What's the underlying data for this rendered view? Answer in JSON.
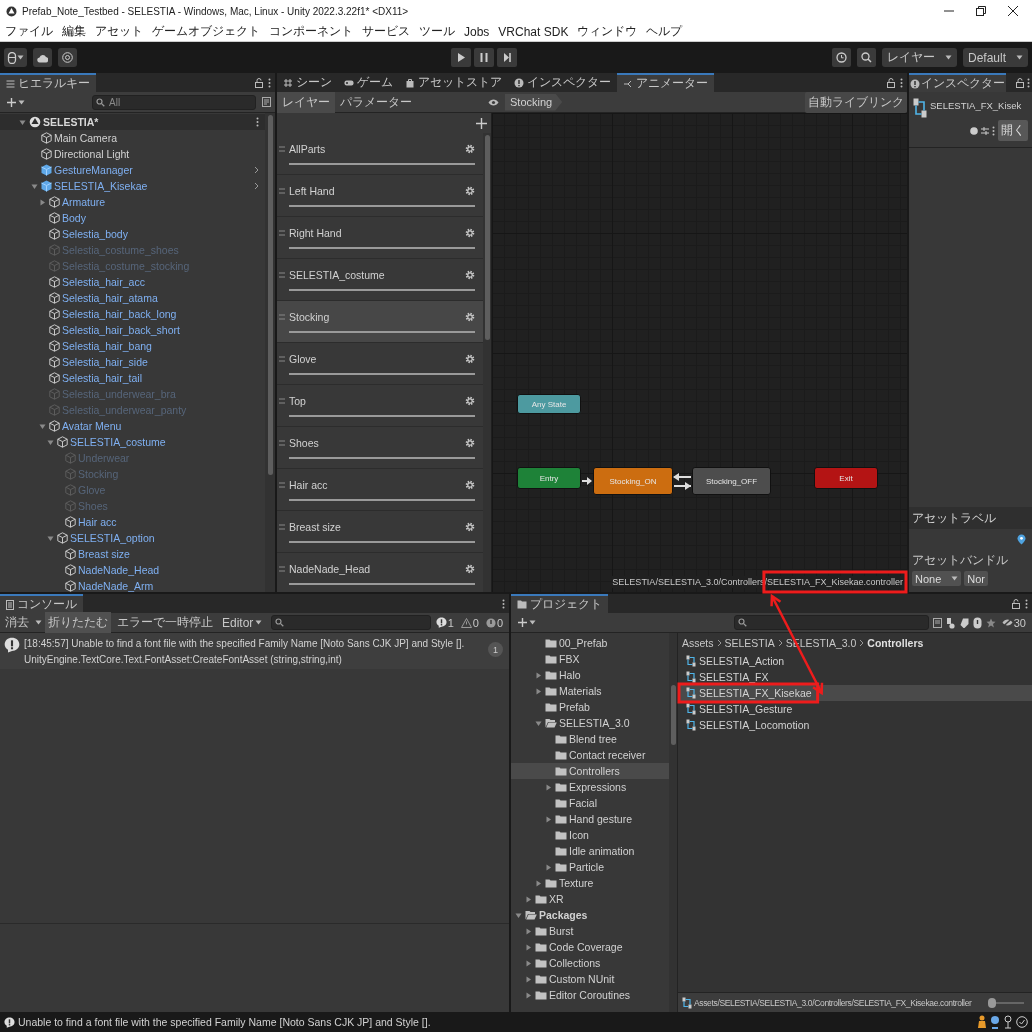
{
  "window": {
    "title": "Prefab_Note_Testbed - SELESTIA - Windows, Mac, Linux - Unity 2022.3.22f1* <DX11>"
  },
  "menu": [
    "ファイル",
    "編集",
    "アセット",
    "ゲームオブジェクト",
    "コンポーネント",
    "サービス",
    "ツール",
    "Jobs",
    "VRChat SDK",
    "ウィンドウ",
    "ヘルプ"
  ],
  "toolbar": {
    "layers_dropdown": "レイヤー",
    "layout_dropdown": "Default"
  },
  "hierarchy": {
    "tab": "ヒエラルキー",
    "search": {
      "placeholder": "All"
    },
    "tree": [
      {
        "label": "SELESTIA*",
        "kind": "scene",
        "expanded": true,
        "children": [
          {
            "label": "Main Camera",
            "kind": "object",
            "active": true
          },
          {
            "label": "Directional Light",
            "kind": "object",
            "active": true
          },
          {
            "label": "GestureManager",
            "kind": "prefab_root",
            "active": true
          },
          {
            "label": "SELESTIA_Kisekae",
            "kind": "prefab_root",
            "active": true,
            "expanded": true,
            "children": [
              {
                "label": "Armature",
                "kind": "prefab_child",
                "active": true,
                "expanded": false
              },
              {
                "label": "Body",
                "kind": "prefab_child",
                "active": true
              },
              {
                "label": "Selestia_body",
                "kind": "prefab_child",
                "active": true
              },
              {
                "label": "Selestia_costume_shoes",
                "kind": "prefab_child",
                "active": false
              },
              {
                "label": "Selestia_costume_stocking",
                "kind": "prefab_child",
                "active": false
              },
              {
                "label": "Selestia_hair_acc",
                "kind": "prefab_child",
                "active": true
              },
              {
                "label": "Selestia_hair_atama",
                "kind": "prefab_child",
                "active": true
              },
              {
                "label": "Selestia_hair_back_long",
                "kind": "prefab_child",
                "active": true
              },
              {
                "label": "Selestia_hair_back_short",
                "kind": "prefab_child",
                "active": true
              },
              {
                "label": "Selestia_hair_bang",
                "kind": "prefab_child",
                "active": true
              },
              {
                "label": "Selestia_hair_side",
                "kind": "prefab_child",
                "active": true
              },
              {
                "label": "Selestia_hair_tail",
                "kind": "prefab_child",
                "active": true
              },
              {
                "label": "Selestia_underwear_bra",
                "kind": "prefab_child",
                "active": false
              },
              {
                "label": "Selestia_underwear_panty",
                "kind": "prefab_child",
                "active": false
              },
              {
                "label": "Avatar Menu",
                "kind": "prefab_child",
                "active": true,
                "expanded": true,
                "children": [
                  {
                    "label": "SELESTIA_costume",
                    "kind": "prefab_child",
                    "active": true,
                    "expanded": true,
                    "children": [
                      {
                        "label": "Underwear",
                        "kind": "prefab_child",
                        "active": false
                      },
                      {
                        "label": "Stocking",
                        "kind": "prefab_child",
                        "active": false
                      },
                      {
                        "label": "Glove",
                        "kind": "prefab_child",
                        "active": false
                      },
                      {
                        "label": "Shoes",
                        "kind": "prefab_child",
                        "active": false
                      },
                      {
                        "label": "Hair acc",
                        "kind": "prefab_child",
                        "active": true
                      }
                    ]
                  },
                  {
                    "label": "SELESTIA_option",
                    "kind": "prefab_child",
                    "active": true,
                    "expanded": true,
                    "children": [
                      {
                        "label": "Breast size",
                        "kind": "prefab_child",
                        "active": true
                      },
                      {
                        "label": "NadeNade_Head",
                        "kind": "prefab_child",
                        "active": true
                      },
                      {
                        "label": "NadeNade_Arm",
                        "kind": "prefab_child",
                        "active": true
                      }
                    ]
                  }
                ]
              }
            ]
          }
        ]
      }
    ]
  },
  "center_tabs": [
    {
      "label": "シーン",
      "kind": "scene",
      "selected": false
    },
    {
      "label": "ゲーム",
      "kind": "game",
      "selected": false
    },
    {
      "label": "アセットストア",
      "kind": "store",
      "selected": false
    },
    {
      "label": "インスペクター",
      "kind": "inspector",
      "selected": false
    },
    {
      "label": "アニメーター",
      "kind": "animator",
      "selected": true
    }
  ],
  "animator": {
    "subtabs": [
      {
        "label": "レイヤー",
        "selected": true
      },
      {
        "label": "パラメーター",
        "selected": false
      }
    ],
    "breadcrumb": "Stocking",
    "live_link": "自動ライブリンク",
    "layers": [
      {
        "name": "AllParts",
        "selected": false
      },
      {
        "name": "Left Hand",
        "selected": false
      },
      {
        "name": "Right Hand",
        "selected": false
      },
      {
        "name": "SELESTIA_costume",
        "selected": false
      },
      {
        "name": "Stocking",
        "selected": true
      },
      {
        "name": "Glove",
        "selected": false
      },
      {
        "name": "Top",
        "selected": false
      },
      {
        "name": "Shoes",
        "selected": false
      },
      {
        "name": "Hair acc",
        "selected": false
      },
      {
        "name": "Breast size",
        "selected": false
      },
      {
        "name": "NadeNade_Head",
        "selected": false
      }
    ],
    "states": [
      {
        "name": "Any State",
        "kind": "any"
      },
      {
        "name": "Entry",
        "kind": "entry"
      },
      {
        "name": "Stocking_ON",
        "kind": "default"
      },
      {
        "name": "Stocking_OFF",
        "kind": "state"
      },
      {
        "name": "Exit",
        "kind": "exit"
      }
    ],
    "path": "SELESTIA/SELESTIA_3.0/Controllers/SELESTIA_FX_Kisekae.controller"
  },
  "inspector": {
    "tab": "インスペクター",
    "asset_name": "SELESTIA_FX_Kisek",
    "open_button": "開く",
    "labels_header": "アセットラベル",
    "bundle_label": "アセットバンドル",
    "bundle": "None",
    "variant": "Nor"
  },
  "console": {
    "tab": "コンソール",
    "clear": "消去",
    "toggles": [
      {
        "label": "折りたたむ",
        "on": true
      },
      {
        "label": "エラーで一時停止",
        "on": false
      }
    ],
    "editor": "Editor",
    "counts": [
      {
        "kind": "log",
        "value": "1"
      },
      {
        "kind": "warning",
        "value": "0"
      },
      {
        "kind": "error",
        "value": "0"
      }
    ],
    "entries": [
      {
        "kind": "log",
        "lines": [
          "[18:45:57] Unable to find a font file with the specified Family Name [Noto Sans CJK JP] and Style [].",
          "UnityEngine.TextCore.Text.FontAsset:CreateFontAsset (string,string,int)"
        ],
        "count": "1"
      }
    ]
  },
  "project": {
    "tab": "プロジェクト",
    "hidden_count": "30",
    "folders": [
      {
        "children": [
          {
            "children": [
              {
                "name": "00_Prefab",
                "selected": false
              },
              {
                "name": "FBX",
                "selected": false
              },
              {
                "name": "Halo",
                "selected": false,
                "expanded": false
              },
              {
                "name": "Materials",
                "selected": false,
                "expanded": false
              },
              {
                "name": "Prefab",
                "selected": false
              },
              {
                "name": "SELESTIA_3.0",
                "selected": false,
                "expanded": true,
                "children": [
                  {
                    "name": "Blend tree",
                    "selected": false
                  },
                  {
                    "name": "Contact receiver",
                    "selected": false
                  },
                  {
                    "name": "Controllers",
                    "selected": true
                  },
                  {
                    "name": "Expressions",
                    "selected": false,
                    "expanded": false
                  },
                  {
                    "name": "Facial",
                    "selected": false
                  },
                  {
                    "name": "Hand gesture",
                    "selected": false,
                    "expanded": false
                  },
                  {
                    "name": "Icon",
                    "selected": false
                  },
                  {
                    "name": "Idle animation",
                    "selected": false
                  },
                  {
                    "name": "Particle",
                    "selected": false,
                    "expanded": false
                  }
                ]
              },
              {
                "name": "Texture",
                "selected": false,
                "expanded": false
              }
            ]
          },
          {
            "name": "XR",
            "selected": false,
            "expanded": false
          }
        ]
      },
      {
        "name": "Packages",
        "selected": false,
        "expanded": true,
        "children": [
          {
            "name": "Burst",
            "selected": false,
            "expanded": false
          },
          {
            "name": "Code Coverage",
            "selected": false,
            "expanded": false
          },
          {
            "name": "Collections",
            "selected": false,
            "expanded": false
          },
          {
            "name": "Custom NUnit",
            "selected": false,
            "expanded": false
          },
          {
            "name": "Editor Coroutines",
            "selected": false,
            "expanded": false
          }
        ]
      }
    ],
    "breadcrumb": [
      "Assets",
      "SELESTIA",
      "SELESTIA_3.0",
      "Controllers"
    ],
    "assets": [
      {
        "name": "SELESTIA_Action",
        "selected": false
      },
      {
        "name": "SELESTIA_FX",
        "selected": false
      },
      {
        "name": "SELESTIA_FX_Kisekae",
        "selected": true
      },
      {
        "name": "SELESTIA_Gesture",
        "selected": false
      },
      {
        "name": "SELESTIA_Locomotion",
        "selected": false
      }
    ],
    "path": "Assets/SELESTIA/SELESTIA_3.0/Controllers/SELESTIA_FX_Kisekae.controller",
    "zoom": {
      "level": 0.05
    }
  },
  "status_bar": {
    "message": "Unable to find a font file with the specified Family Name [Noto Sans CJK JP] and Style []."
  }
}
